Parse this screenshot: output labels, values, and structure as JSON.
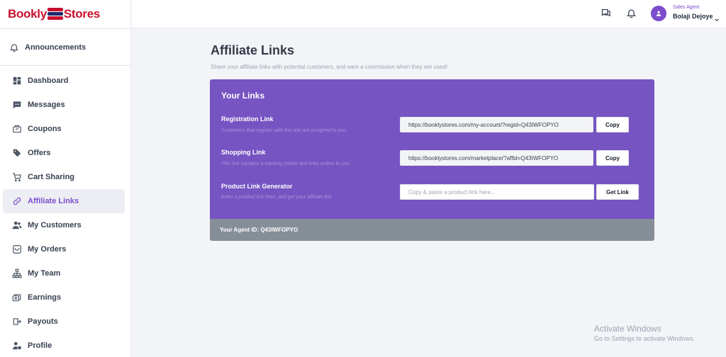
{
  "brand": {
    "part1": "Bookly",
    "part2": "Stores"
  },
  "sidebar": {
    "announcements": {
      "label": "Announcements",
      "icon": "bell-icon"
    },
    "items": [
      {
        "label": "Dashboard",
        "icon": "dashboard-icon",
        "active": false
      },
      {
        "label": "Messages",
        "icon": "message-icon",
        "active": false
      },
      {
        "label": "Coupons",
        "icon": "coupon-icon",
        "active": false
      },
      {
        "label": "Offers",
        "icon": "tag-icon",
        "active": false
      },
      {
        "label": "Cart Sharing",
        "icon": "cart-icon",
        "active": false
      },
      {
        "label": "Affiliate Links",
        "icon": "link-icon",
        "active": true
      },
      {
        "label": "My Customers",
        "icon": "users-icon",
        "active": false
      },
      {
        "label": "My Orders",
        "icon": "orders-icon",
        "active": false
      },
      {
        "label": "My Team",
        "icon": "team-icon",
        "active": false
      },
      {
        "label": "Earnings",
        "icon": "earnings-icon",
        "active": false
      },
      {
        "label": "Payouts",
        "icon": "payout-icon",
        "active": false
      },
      {
        "label": "Profile",
        "icon": "profile-icon",
        "active": false
      }
    ]
  },
  "header": {
    "user_role": "Sales Agent",
    "user_name": "Bolaji Dejoye"
  },
  "page": {
    "title": "Affiliate Links",
    "subtitle": "Share your affiliate links with potential customers, and earn a commission when they are used!"
  },
  "links_card": {
    "title": "Your Links",
    "rows": [
      {
        "label": "Registration Link",
        "description": "Customers that register with this link are assigned to you.",
        "value": "https://booklystores.com/my-account/?regid=Q43IWFOPYO",
        "button": "Copy"
      },
      {
        "label": "Shopping Link",
        "description": "This link contains a tracking cookie and links orders to you.",
        "value": "https://booklystores.com/marketplace/?affid=Q43IWFOPYO",
        "button": "Copy"
      },
      {
        "label": "Product Link Generator",
        "description": "Enter a product link here, and get your affiliate link.",
        "placeholder": "Copy & paste a product link here...",
        "button": "Get Link"
      }
    ],
    "footer": "Your Agent ID: Q43IWFOPYO"
  },
  "watermark": {
    "title": "Activate Windows",
    "subtitle": "Go to Settings to activate Windows."
  },
  "colors": {
    "accent": "#7c4dcc",
    "card": "#7654c2",
    "footer": "#868e98",
    "brand_red": "#c8102e",
    "brand_navy": "#1f2a6b"
  }
}
